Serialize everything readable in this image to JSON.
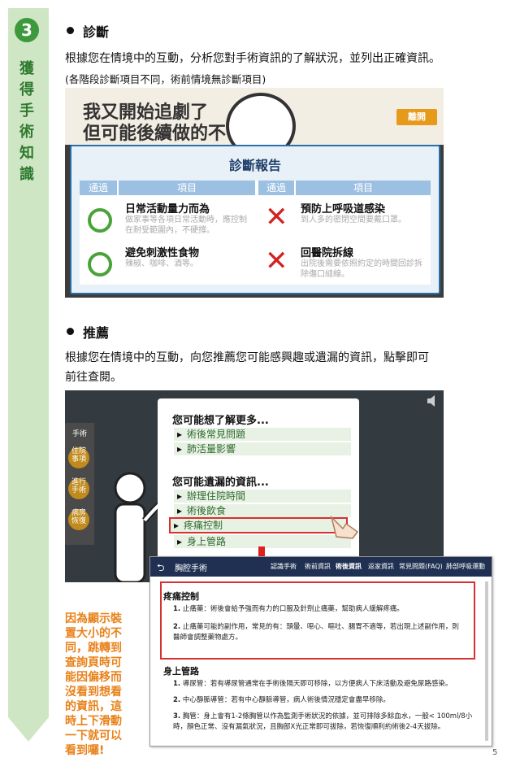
{
  "sidebar": {
    "step_number": "3",
    "title_chars": [
      "獲",
      "得",
      "手",
      "術",
      "知",
      "識"
    ]
  },
  "diagnosis": {
    "heading": "診斷",
    "desc": "根據您在情境中的互動，分析您對手術資訊的了解狀況，並列出正確資訊。",
    "note": "(各階段診斷項目不同，術前情境無診斷項目)"
  },
  "shot1": {
    "scene_title_1": "我又開始追劇了",
    "scene_title_2": "但可能後續做的不",
    "leave_button": "離開",
    "report_title": "診斷報告",
    "col_pass": "通過",
    "col_item": "項目",
    "items": [
      {
        "result": "pass",
        "title": "日常活動量力而為",
        "sub": "做家事等各項日常活動時，應控制在耐受範圍內，不硬撐。"
      },
      {
        "result": "fail",
        "title": "預防上呼吸道感染",
        "sub": "到人多的密閉空間要戴口罩。"
      },
      {
        "result": "pass",
        "title": "避免刺激性食物",
        "sub": "辣椒、咖啡、酒等。"
      },
      {
        "result": "fail",
        "title": "回醫院拆線",
        "sub": "出院後需要依照約定的時間回診拆除傷口縫線。"
      }
    ]
  },
  "recommend": {
    "heading": "推薦",
    "desc_line1": "根據您在情境中的互動，向您推薦您可能感興趣或遺漏的資訊，點擊即可",
    "desc_line2": "前往查閱。"
  },
  "shot2": {
    "side_label": "手術",
    "side_buttons": [
      "住院事項",
      "進行手術",
      "病房恢復"
    ],
    "section1_title": "您可能想了解更多...",
    "section1_items": [
      "術後常見問題",
      "肺活量影響"
    ],
    "section2_title": "您可能遺漏的資訊...",
    "section2_items": [
      "辦理住院時間",
      "術後飲食",
      "疼痛控制",
      "身上管路"
    ]
  },
  "web": {
    "site_title": "胸腔手術",
    "nav": [
      "認識手術",
      "術前資訊",
      "術後資訊",
      "返家資訊",
      "常見問題(FAQ)",
      "肺部呼吸運動"
    ],
    "pain_title": "疼痛控制",
    "pain_items": [
      "止痛藥：術後會給予強而有力的口服及針劑止痛藥，幫助病人緩解疼痛。",
      "止痛藥可能的副作用，常見的有：頭暈、噁心、嘔吐、腸胃不適等，若出現上述副作用，則醫師會調整藥物處方。"
    ],
    "tube_title": "身上管路",
    "tube_items": [
      "導尿管：若有導尿管通常在手術後隔天即可移除，以方便病人下床活動及避免尿路感染。",
      "中心靜脈導管：若有中心靜脈導管，病人術後情況穩定會盡早移除。",
      "胸管：身上會有1-2條胸管以作為監測手術狀況的依據，並可排除多餘血水，一般< 100ml/8小時，顏色正常、沒有漏氣狀況，且胸部X光正常即可拔除，若恢復順利約術後2-4天拔除。"
    ]
  },
  "note_text": "因為顯示裝置大小的不同，跳轉到查詢頁時可能因偏移而沒看到想看的資訊，這時上下滑動一下就可以看到囉!",
  "page_number": "5"
}
